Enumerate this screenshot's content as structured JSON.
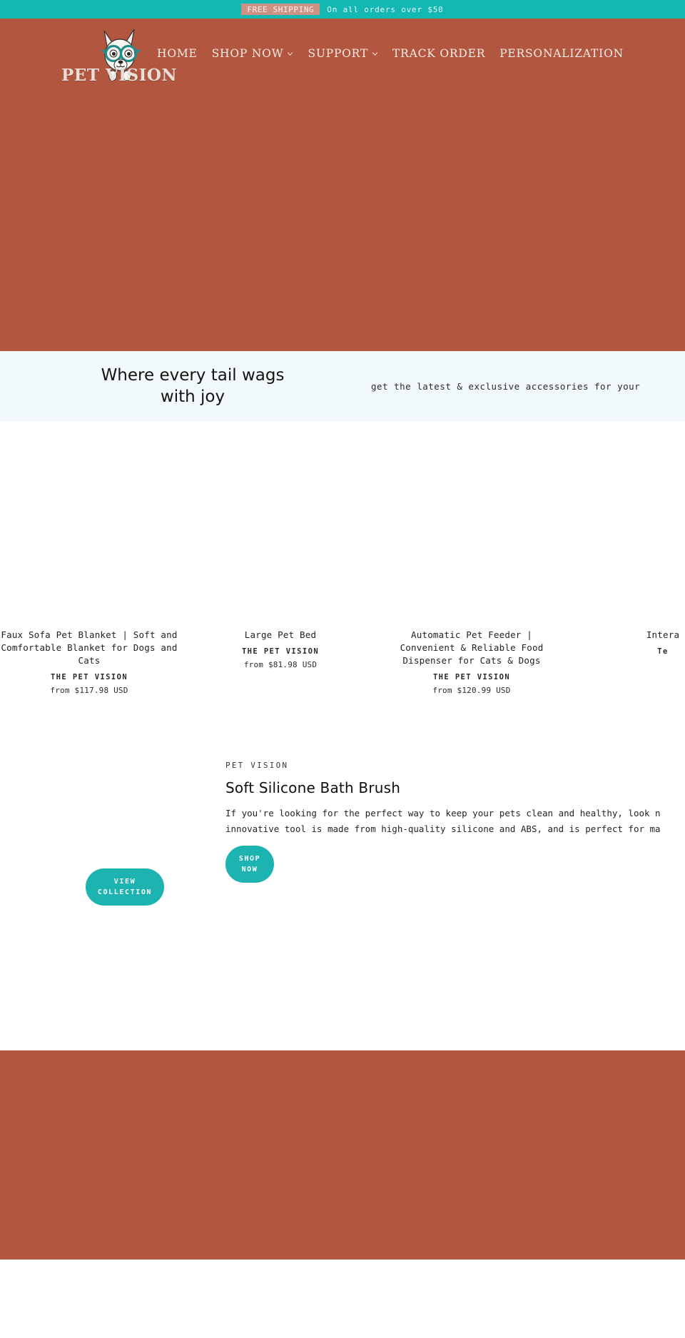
{
  "announcement": {
    "badge": "FREE SHIPPING",
    "text": "On all orders over $50",
    "badge_bg": "#cc9284",
    "bar_bg": "#13b8b4"
  },
  "header": {
    "logo_word": "PET VISION",
    "logo_icon": "dog-with-glasses-logo",
    "bg": "#b2563f",
    "nav": [
      {
        "label": "HOME",
        "has_dropdown": false
      },
      {
        "label": "SHOP NOW",
        "has_dropdown": true
      },
      {
        "label": "SUPPORT",
        "has_dropdown": true
      },
      {
        "label": "TRACK ORDER",
        "has_dropdown": false
      },
      {
        "label": "PERSONALIZATION",
        "has_dropdown": false
      }
    ]
  },
  "tagline": {
    "title": "Where every tail wags with joy",
    "subtitle": "get the latest & exclusive accessories for your",
    "bg": "#f2f9fa"
  },
  "products": [
    {
      "title": "Faux Sofa Pet Blanket | Soft and Comfortable Blanket for Dogs and Cats",
      "vendor": "THE PET VISION",
      "price": "from $117.98 USD"
    },
    {
      "title": "Large Pet Bed",
      "vendor": "THE PET VISION",
      "price": "from $81.98 USD"
    },
    {
      "title": "Automatic Pet Feeder | Convenient & Reliable Food Dispenser for Cats & Dogs",
      "vendor": "THE PET VISION",
      "price": "from $120.99 USD"
    },
    {
      "title": "Intera",
      "vendor": "Te",
      "price": ""
    }
  ],
  "collection": {
    "view_button": "VIEW COLLECTION"
  },
  "featured": {
    "vendor": "PET VISION",
    "title": "Soft Silicone Bath Brush",
    "description_line1": "If you're looking for the perfect way to keep your pets clean and healthy, look n",
    "description_line2": "innovative tool is made from high-quality silicone and ABS, and is perfect for ma",
    "shop_button": "SHOP NOW"
  },
  "theme": {
    "teal": "#13b8b4",
    "terracotta": "#b2563f",
    "button_teal": "#1cb3b0"
  }
}
